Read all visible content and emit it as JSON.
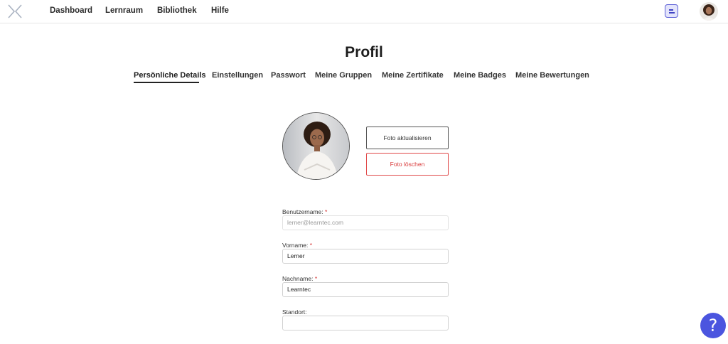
{
  "nav": {
    "items": [
      "Dashboard",
      "Lernraum",
      "Bibliothek",
      "Hilfe"
    ]
  },
  "page": {
    "title": "Profil"
  },
  "tabs": [
    {
      "label": "Persönliche Details",
      "active": true
    },
    {
      "label": "Einstellungen",
      "active": false
    },
    {
      "label": "Passwort",
      "active": false
    },
    {
      "label": "Meine Gruppen",
      "active": false
    },
    {
      "label": "Meine Zertifikate",
      "active": false
    },
    {
      "label": "Meine Badges",
      "active": false
    },
    {
      "label": "Meine Bewertungen",
      "active": false
    }
  ],
  "photo": {
    "update_label": "Foto aktualisieren",
    "delete_label": "Foto löschen"
  },
  "form": {
    "username": {
      "label": "Benutzername:",
      "required_mark": "*",
      "value": "lerner@learntec.com",
      "disabled": true
    },
    "firstname": {
      "label": "Vorname:",
      "required_mark": "*",
      "value": "Lerner"
    },
    "lastname": {
      "label": "Nachname:",
      "required_mark": "*",
      "value": "Learntec"
    },
    "location": {
      "label": "Standort:",
      "value": ""
    }
  },
  "help": {
    "label": "?"
  },
  "colors": {
    "accent": "#4b55df",
    "danger": "#d93b3b",
    "required": "#d32f2f"
  },
  "icons": [
    "logo-icon",
    "menu-icon",
    "user-avatar",
    "help-icon"
  ]
}
